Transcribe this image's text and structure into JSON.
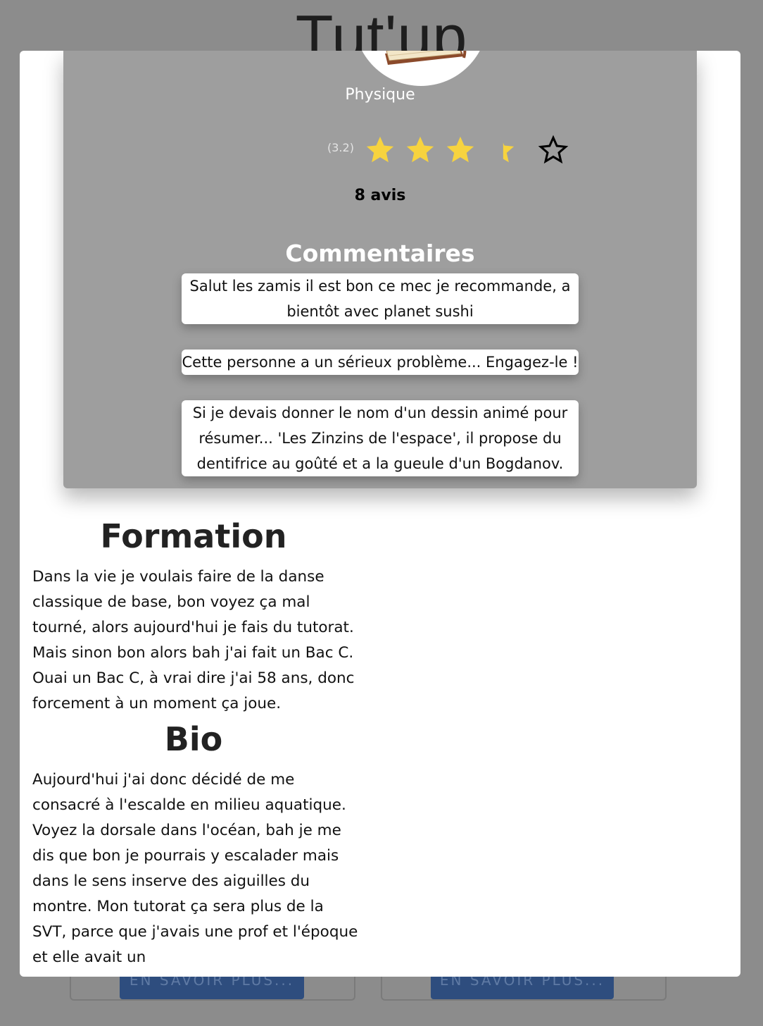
{
  "app": {
    "title": "Tut'up"
  },
  "background": {
    "buttons": [
      "EN SAVOIR PLUS...",
      "EN SAVOIR PLUS..."
    ]
  },
  "profile": {
    "subject": "Physique",
    "rating": {
      "label": "(3.2)",
      "value": 3.2,
      "max": 5,
      "star_color": "#f7d33f"
    },
    "reviews": "8 avis",
    "comments_title": "Commentaires",
    "comments": [
      "Salut les zamis il est bon ce mec je recommande, a bientôt avec planet sushi",
      "Cette personne a un sérieux problème... Engagez-le !",
      "Si je devais donner le nom d'un dessin animé pour résumer... 'Les Zinzins de l'espace', il propose du dentifrice au goûté et a la gueule d'un Bogdanov."
    ]
  },
  "formation": {
    "title": "Formation",
    "text": "Dans la vie je voulais faire de la danse classique de base, bon voyez ça mal tourné, alors aujourd'hui je fais du tutorat. Mais sinon bon alors bah j'ai fait un Bac C. Ouai un Bac C, à vrai dire j'ai 58 ans, donc forcement à un moment ça joue."
  },
  "bio": {
    "title": "Bio",
    "text": "Aujourd'hui j'ai donc décidé de me consacré à l'escalde en milieu aquatique. Voyez la dorsale dans l'océan, bah je me dis que bon je pourrais y escalader mais dans le sens inserve des aiguilles du montre. Mon tutorat ça sera plus de la SVT, parce que j'avais une prof et l'époque et elle avait un"
  }
}
